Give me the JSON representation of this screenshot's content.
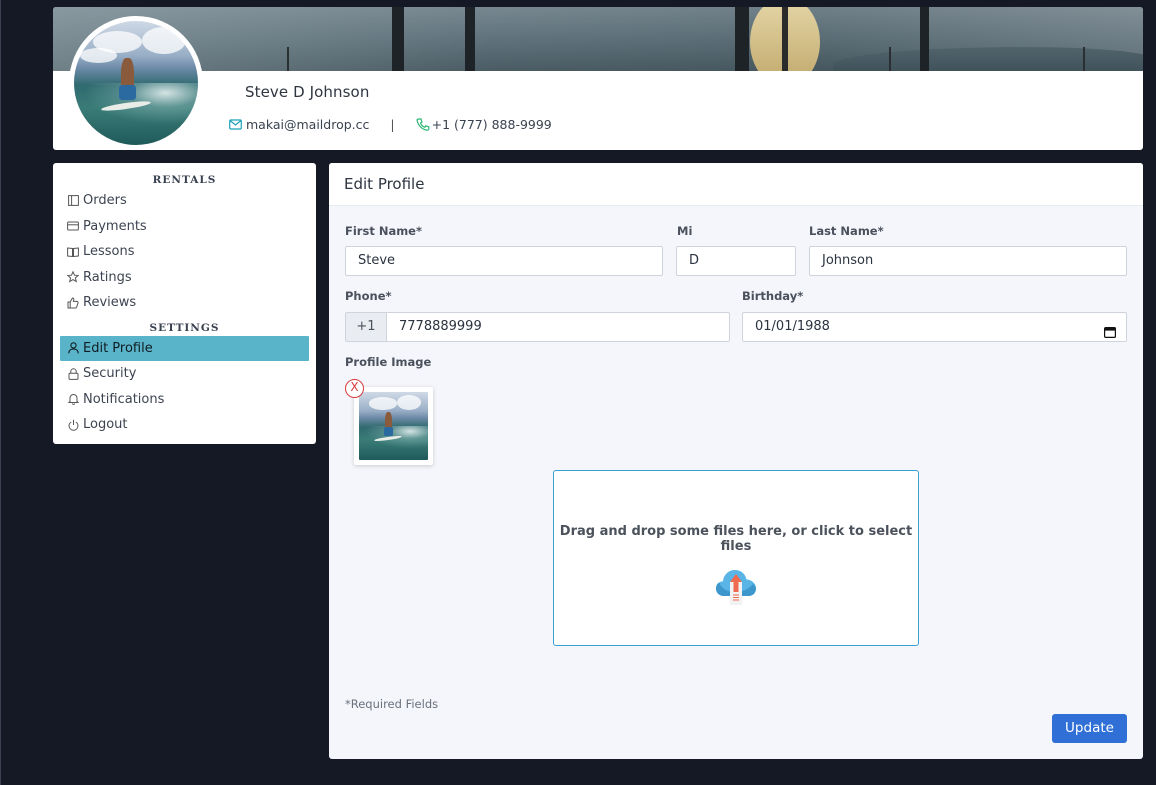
{
  "profile": {
    "name": "Steve D Johnson",
    "email": "makai@maildrop.cc",
    "separator": "|",
    "phone": "+1 (777) 888-9999",
    "avatar_icon": "profile-photo"
  },
  "sidebar": {
    "sections": [
      {
        "title": "RENTALS",
        "items": [
          {
            "label": "Orders",
            "icon": "orders-icon"
          },
          {
            "label": "Payments",
            "icon": "credit-card-icon"
          },
          {
            "label": "Lessons",
            "icon": "book-icon"
          },
          {
            "label": "Ratings",
            "icon": "star-icon"
          },
          {
            "label": "Reviews",
            "icon": "thumbs-up-icon"
          }
        ]
      },
      {
        "title": "SETTINGS",
        "items": [
          {
            "label": "Edit Profile",
            "icon": "user-icon",
            "active": true
          },
          {
            "label": "Security",
            "icon": "lock-icon"
          },
          {
            "label": "Notifications",
            "icon": "bell-icon"
          },
          {
            "label": "Logout",
            "icon": "power-icon"
          }
        ]
      }
    ],
    "active_color": "#5ab4c9"
  },
  "form": {
    "title": "Edit Profile",
    "first_name": {
      "label": "First Name*",
      "value": "Steve"
    },
    "mi": {
      "label": "Mi",
      "value": "D"
    },
    "last_name": {
      "label": "Last Name*",
      "value": "Johnson"
    },
    "phone": {
      "label": "Phone*",
      "prefix": "+1",
      "value": "7778889999"
    },
    "birthday": {
      "label": "Birthday*",
      "value": "01/01/1988"
    },
    "profile_image": {
      "label": "Profile Image",
      "remove_label": "X"
    },
    "dropzone_text": "Drag and drop some files here, or click to select files",
    "required_note": "*Required Fields",
    "submit_label": "Update"
  },
  "colors": {
    "background": "#141925",
    "accent": "#5ab4c9",
    "button": "#2f6fd6",
    "dropzone_border": "#3aa0d0",
    "remove": "#d63a3a"
  }
}
